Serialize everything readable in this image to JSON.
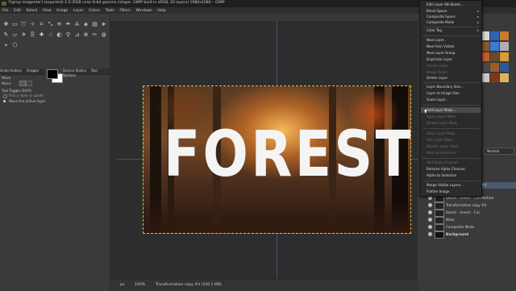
{
  "window": {
    "title": "*[gimp-imagenter] (exported)-2.0 (RGB color 8-bit gamma integer, GIMP built-in sRGB, 20 layers) 1980x1080 – GIMP"
  },
  "menubar": [
    "File",
    "Edit",
    "Select",
    "View",
    "Image",
    "Layer",
    "Colors",
    "Tools",
    "Filters",
    "Windows",
    "Help"
  ],
  "toolbox": {
    "panel_tabs": [
      "Undo History",
      "Images",
      "Device Status",
      "Tool Options"
    ],
    "options_title": "Move",
    "move_label": "Move:",
    "tool_toggle": "Tool Toggle  (Shift)",
    "opt1": "Pick a layer or guide",
    "opt2": "Move the active layer"
  },
  "canvas": {
    "image_text": "FOREST"
  },
  "statusbar": {
    "unit": "px",
    "zoom": "100%",
    "layer_info": "Transformation copy #4 (430.1 MB)"
  },
  "rightdock": {
    "mode_label": "Normal",
    "layers": [
      "Transformation copy #4",
      "Select – Invert – Cut Method",
      "Transformation copy #3",
      "Select – Invert – Cut",
      "Mask",
      "Composite Mode",
      "Background"
    ]
  },
  "context_menu": {
    "items": [
      {
        "label": "Edit Layer Attributes...",
        "disabled": false
      },
      {
        "label": "Blend Space",
        "disabled": false,
        "submenu": true
      },
      {
        "label": "Composite Space",
        "disabled": false,
        "submenu": true
      },
      {
        "label": "Composite Mode",
        "disabled": false,
        "submenu": true
      },
      {
        "label": "Color Tag",
        "disabled": false,
        "submenu": true
      },
      {
        "label": "New Layer...",
        "disabled": false
      },
      {
        "label": "New from Visible",
        "disabled": false
      },
      {
        "label": "New Layer Group",
        "disabled": false
      },
      {
        "label": "Duplicate Layer",
        "disabled": false
      },
      {
        "label": "Anchor Layer",
        "disabled": true
      },
      {
        "label": "Merge Down",
        "disabled": true
      },
      {
        "label": "Delete Layer",
        "disabled": false
      },
      {
        "label": "Layer Boundary Size...",
        "disabled": false
      },
      {
        "label": "Layer to Image Size",
        "disabled": false
      },
      {
        "label": "Scale Layer...",
        "disabled": false
      },
      {
        "label": "Add Layer Mask...",
        "disabled": false
      },
      {
        "label": "Apply Layer Mask",
        "disabled": true
      },
      {
        "label": "Delete Layer Mask",
        "disabled": true
      },
      {
        "label": "Show Layer Mask",
        "disabled": true
      },
      {
        "label": "Edit Layer Mask",
        "disabled": true
      },
      {
        "label": "Disable Layer Mask",
        "disabled": true
      },
      {
        "label": "Mask to Selection",
        "disabled": true
      },
      {
        "label": "Add Alpha Channel",
        "disabled": true
      },
      {
        "label": "Remove Alpha Channel",
        "disabled": false
      },
      {
        "label": "Alpha to Selection",
        "disabled": false
      },
      {
        "label": "Merge Visible Layers...",
        "disabled": false
      },
      {
        "label": "Flatten Image",
        "disabled": false
      }
    ]
  }
}
